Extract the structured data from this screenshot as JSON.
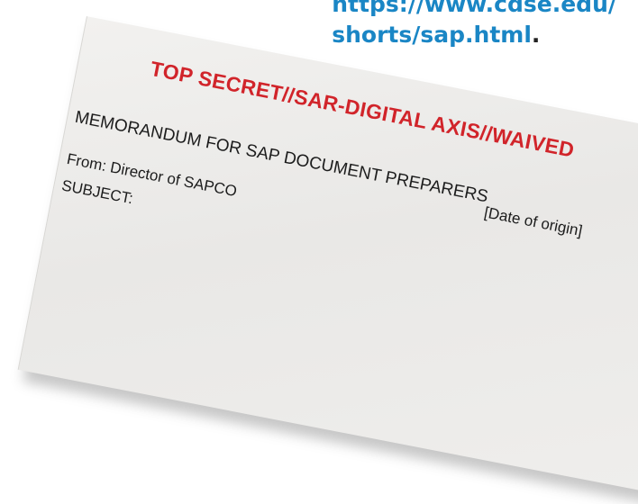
{
  "link": {
    "line1": "https://www.cdse.edu/",
    "line2": "shorts/sap.html",
    "period": "."
  },
  "memo": {
    "classification": "TOP SECRET//SAR-DIGITAL AXIS//WAIVED",
    "addressee": "MEMORANDUM FOR SAP DOCUMENT PREPARERS",
    "date": "[Date of origin]",
    "from": "From: Director of SAPCO",
    "subject": "SUBJECT:"
  },
  "colors": {
    "link": "#1a86c5",
    "classification": "#d1242a",
    "paper": "#efeeec"
  }
}
